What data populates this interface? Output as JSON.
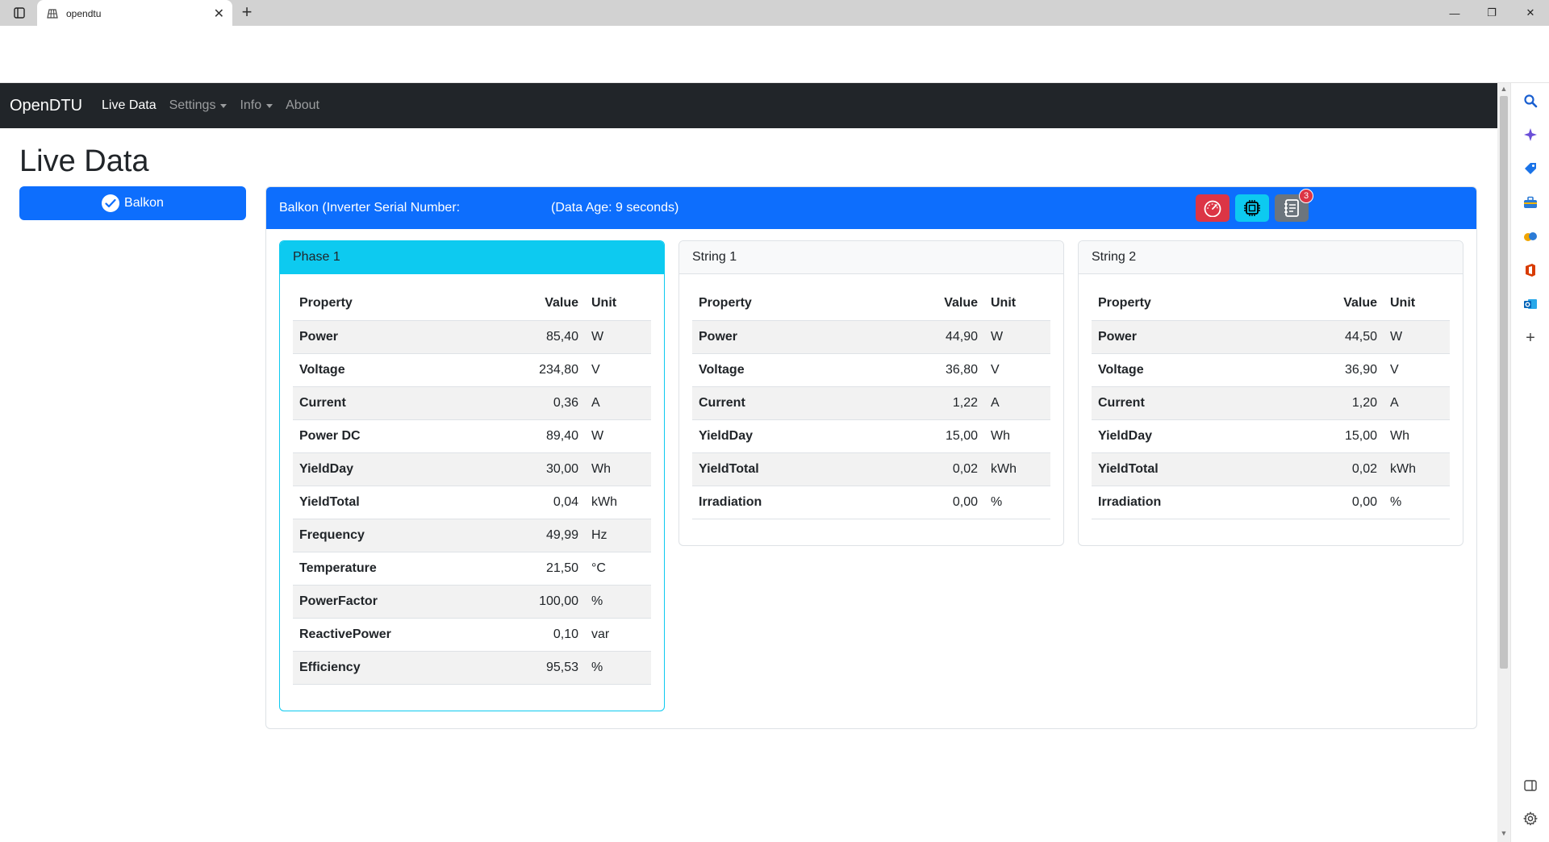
{
  "browser": {
    "tab_title": "opendtu",
    "new_tab": "+",
    "close_tab": "✕",
    "minimize": "—",
    "restore": "❐",
    "close_window": "✕"
  },
  "navbar": {
    "brand": "OpenDTU",
    "links": [
      "Live Data",
      "Settings",
      "Info",
      "About"
    ]
  },
  "page": {
    "title": "Live Data",
    "inverter_button": "Balkon"
  },
  "inverter_card": {
    "title": "Balkon (Inverter Serial Number:",
    "data_age": "(Data Age: 9 seconds)",
    "events_badge": "3"
  },
  "columns": {
    "property": "Property",
    "value": "Value",
    "unit": "Unit"
  },
  "panels": [
    {
      "name": "Phase 1",
      "rows": [
        {
          "property": "Power",
          "value": "85,40",
          "unit": "W"
        },
        {
          "property": "Voltage",
          "value": "234,80",
          "unit": "V"
        },
        {
          "property": "Current",
          "value": "0,36",
          "unit": "A"
        },
        {
          "property": "Power DC",
          "value": "89,40",
          "unit": "W"
        },
        {
          "property": "YieldDay",
          "value": "30,00",
          "unit": "Wh"
        },
        {
          "property": "YieldTotal",
          "value": "0,04",
          "unit": "kWh"
        },
        {
          "property": "Frequency",
          "value": "49,99",
          "unit": "Hz"
        },
        {
          "property": "Temperature",
          "value": "21,50",
          "unit": "°C"
        },
        {
          "property": "PowerFactor",
          "value": "100,00",
          "unit": "%"
        },
        {
          "property": "ReactivePower",
          "value": "0,10",
          "unit": "var"
        },
        {
          "property": "Efficiency",
          "value": "95,53",
          "unit": "%"
        }
      ]
    },
    {
      "name": "String 1",
      "rows": [
        {
          "property": "Power",
          "value": "44,90",
          "unit": "W"
        },
        {
          "property": "Voltage",
          "value": "36,80",
          "unit": "V"
        },
        {
          "property": "Current",
          "value": "1,22",
          "unit": "A"
        },
        {
          "property": "YieldDay",
          "value": "15,00",
          "unit": "Wh"
        },
        {
          "property": "YieldTotal",
          "value": "0,02",
          "unit": "kWh"
        },
        {
          "property": "Irradiation",
          "value": "0,00",
          "unit": "%"
        }
      ]
    },
    {
      "name": "String 2",
      "rows": [
        {
          "property": "Power",
          "value": "44,50",
          "unit": "W"
        },
        {
          "property": "Voltage",
          "value": "36,90",
          "unit": "V"
        },
        {
          "property": "Current",
          "value": "1,20",
          "unit": "A"
        },
        {
          "property": "YieldDay",
          "value": "15,00",
          "unit": "Wh"
        },
        {
          "property": "YieldTotal",
          "value": "0,02",
          "unit": "kWh"
        },
        {
          "property": "Irradiation",
          "value": "0,00",
          "unit": "%"
        }
      ]
    }
  ],
  "colors": {
    "navbar": "#212529",
    "primary": "#0d6efd",
    "info": "#0dcaf0",
    "danger": "#dc3545",
    "secondary": "#6c757d"
  },
  "icons": {
    "head_buttons": [
      "speedometer-icon",
      "cpu-icon",
      "journal-text-icon"
    ],
    "edge_sidebar": [
      "search-icon",
      "copilot-icon",
      "shopping-tag-icon",
      "toolbox-icon",
      "games-icon",
      "office-icon",
      "outlook-icon",
      "add-icon",
      "sidebar-layout-icon",
      "settings-gear-icon"
    ]
  }
}
